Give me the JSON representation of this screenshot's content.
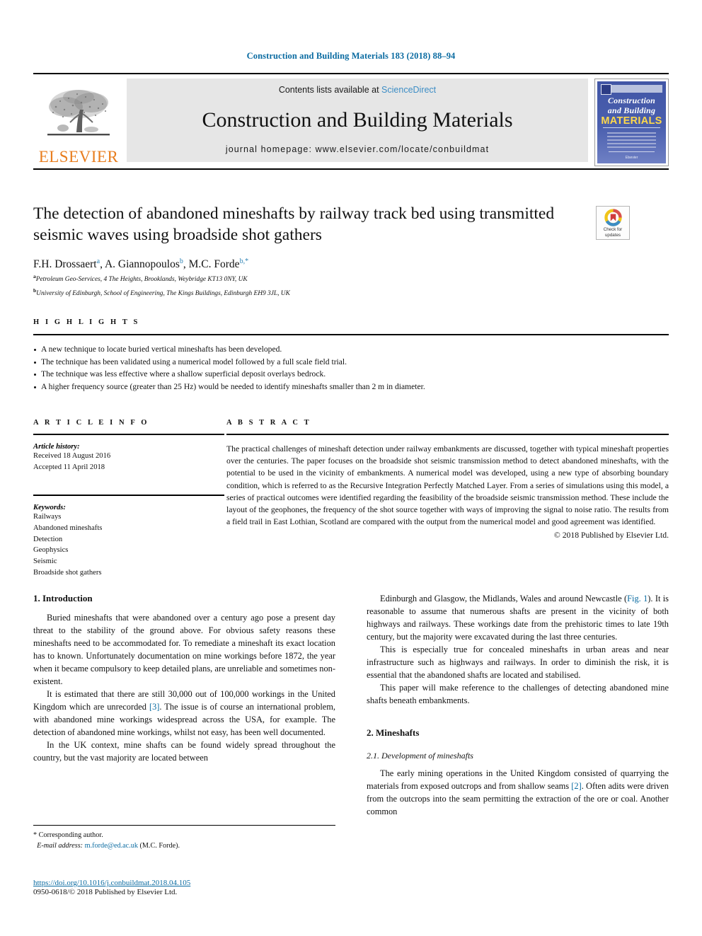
{
  "running_head": "Construction and Building Materials 183 (2018) 88–94",
  "masthead": {
    "contents_prefix": "Contents lists available at",
    "sciencedirect": "ScienceDirect",
    "journal_name": "Construction and Building Materials",
    "homepage": "journal homepage: www.elsevier.com/locate/conbuildmat",
    "publisher_wordmark": "ELSEVIER",
    "cover": {
      "line1": "Construction",
      "line2": "and Building",
      "line3": "MATERIALS",
      "footer": "Elsevier"
    }
  },
  "title": "The detection of abandoned mineshafts by railway track bed using transmitted seismic waves using broadside shot gathers",
  "authors": [
    {
      "name": "F.H. Drossaert",
      "marks": "a"
    },
    {
      "name": "A. Giannopoulos",
      "marks": "b"
    },
    {
      "name": "M.C. Forde",
      "marks": "b,*"
    }
  ],
  "affiliations": [
    {
      "mark": "a",
      "text": "Petroleum Geo-Services, 4 The Heights, Brooklands, Weybridge KT13 0NY, UK"
    },
    {
      "mark": "b",
      "text": "University of Edinburgh, School of Engineering, The Kings Buildings, Edinburgh EH9 3JL, UK"
    }
  ],
  "crossmark": {
    "line1": "Check for",
    "line2": "updates"
  },
  "highlights": {
    "heading": "H I G H L I G H T S",
    "items": [
      "A new technique to locate buried vertical mineshafts has been developed.",
      "The technique has been validated using a numerical model followed by a full scale field trial.",
      "The technique was less effective where a shallow superficial deposit overlays bedrock.",
      "A higher frequency source (greater than 25 Hz) would be needed to identify mineshafts smaller than 2 m in diameter."
    ]
  },
  "article_info": {
    "heading": "A R T I C L E   I N F O",
    "history_label": "Article history:",
    "history": [
      "Received 18 August 2016",
      "Accepted 11 April 2018"
    ],
    "keywords_label": "Keywords:",
    "keywords": [
      "Railways",
      "Abandoned mineshafts",
      "Detection",
      "Geophysics",
      "Seismic",
      "Broadside shot gathers"
    ]
  },
  "abstract": {
    "heading": "A B S T R A C T",
    "text": "The practical challenges of mineshaft detection under railway embankments are discussed, together with typical mineshaft properties over the centuries. The paper focuses on the broadside shot seismic transmission method to detect abandoned mineshafts, with the potential to be used in the vicinity of embankments. A numerical model was developed, using a new type of absorbing boundary condition, which is referred to as the Recursive Integration Perfectly Matched Layer. From a series of simulations using this model, a series of practical outcomes were identified regarding the feasibility of the broadside seismic transmission method. These include the layout of the geophones, the frequency of the shot source together with ways of improving the signal to noise ratio. The results from a field trail in East Lothian, Scotland are compared with the output from the numerical model and good agreement was identified.",
    "copyright": "© 2018 Published by Elsevier Ltd."
  },
  "body": {
    "left": {
      "section_heading": "1. Introduction",
      "paragraphs": [
        "Buried mineshafts that were abandoned over a century ago pose a present day threat to the stability of the ground above. For obvious safety reasons these mineshafts need to be accommodated for. To remediate a mineshaft its exact location has to known. Unfortunately documentation on mine workings before 1872, the year when it became compulsory to keep detailed plans, are unreliable and sometimes non-existent.",
        "It is estimated that there are still 30,000 out of 100,000 workings in the United Kingdom which are unrecorded [3]. The issue is of course an international problem, with abandoned mine workings widespread across the USA, for example. The detection of abandoned mine workings, whilst not easy, has been well documented.",
        "In the UK context, mine shafts can be found widely spread throughout the country, but the vast majority are located between"
      ]
    },
    "right": {
      "paragraphs": [
        "Edinburgh and Glasgow, the Midlands, Wales and around Newcastle (Fig. 1). It is reasonable to assume that numerous shafts are present in the vicinity of both highways and railways. These workings date from the prehistoric times to late 19th century, but the majority were excavated during the last three centuries.",
        "This is especially true for concealed mineshafts in urban areas and near infrastructure such as highways and railways. In order to diminish the risk, it is essential that the abandoned shafts are located and stabilised.",
        "This paper will make reference to the challenges of detecting abandoned mine shafts beneath embankments."
      ],
      "section_heading": "2. Mineshafts",
      "subsection_heading": "2.1. Development of mineshafts",
      "subsection_paragraph": "The early mining operations in the United Kingdom consisted of quarrying the materials from exposed outcrops and from shallow seams [2]. Often adits were driven from the outcrops into the seam permitting the extraction of the ore or coal. Another common"
    }
  },
  "footnote": {
    "corresponding": "* Corresponding author.",
    "email_label": "E-mail address:",
    "email": "m.forde@ed.ac.uk",
    "email_suffix": "(M.C. Forde)."
  },
  "footer": {
    "doi": "https://doi.org/10.1016/j.conbuildmat.2018.04.105",
    "issn_line": "0950-0618/© 2018 Published by Elsevier Ltd."
  },
  "colors": {
    "link": "#0a6ba1",
    "sciencedirect": "#3c8dc5",
    "elsevier_orange": "#e87d1e",
    "cover_blue": "#4156a6",
    "cover_yellow": "#ffd94a"
  }
}
